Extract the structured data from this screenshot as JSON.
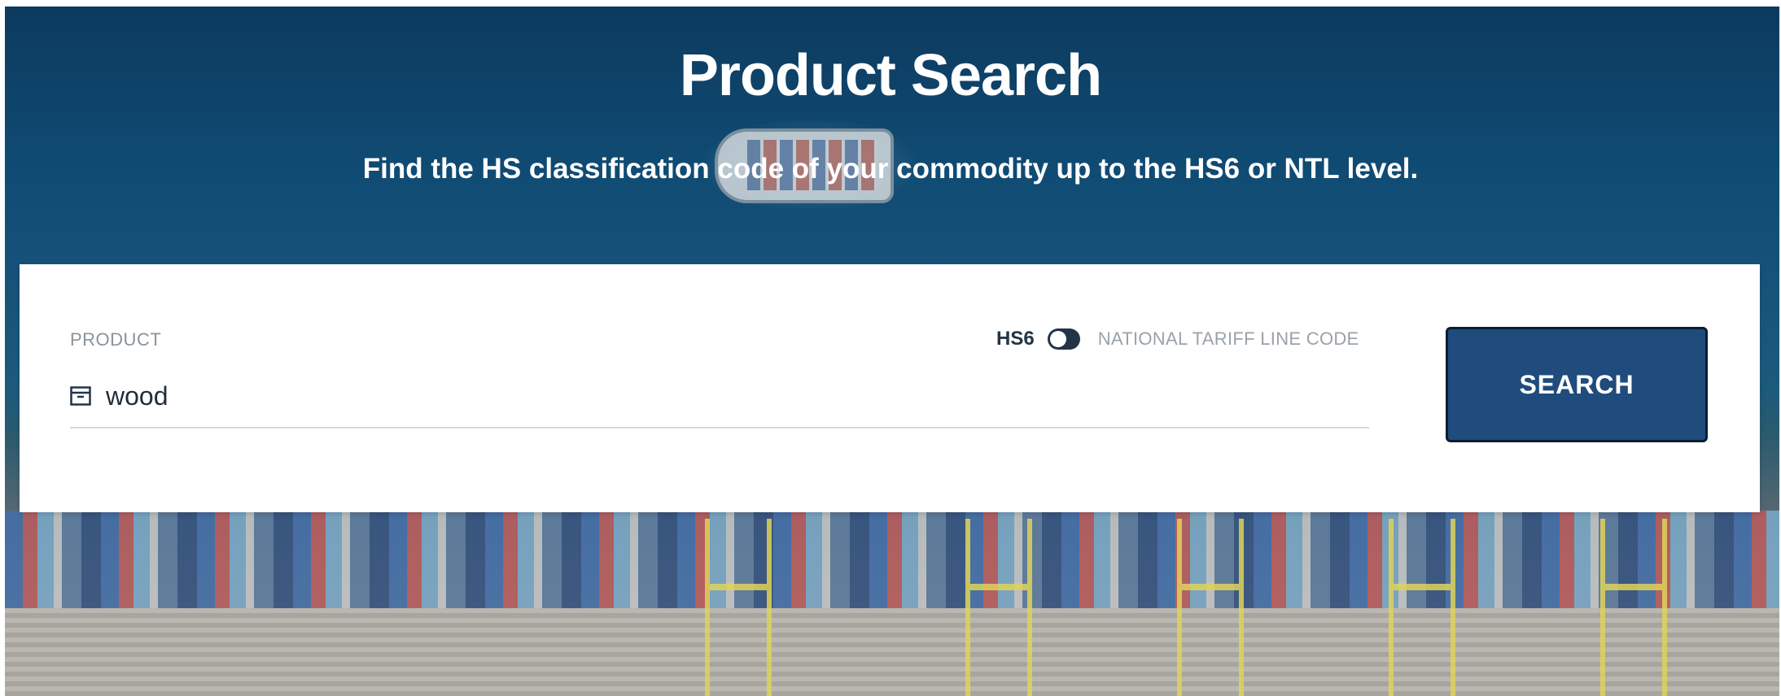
{
  "page": {
    "title": "Product Search",
    "subtitle": "Find the HS classification code of your commodity up to the HS6 or NTL level."
  },
  "search_form": {
    "field_label": "PRODUCT",
    "field_icon": "archive-box-icon",
    "input_value": "wood",
    "toggle": {
      "left_label": "HS6",
      "right_label": "NATIONAL TARIFF LINE CODE",
      "selected": "HS6"
    },
    "search_button_label": "SEARCH"
  },
  "colors": {
    "primary_button": "#1f4b7d",
    "toggle_active": "#233447",
    "hero_dark": "#0d3a5f"
  }
}
